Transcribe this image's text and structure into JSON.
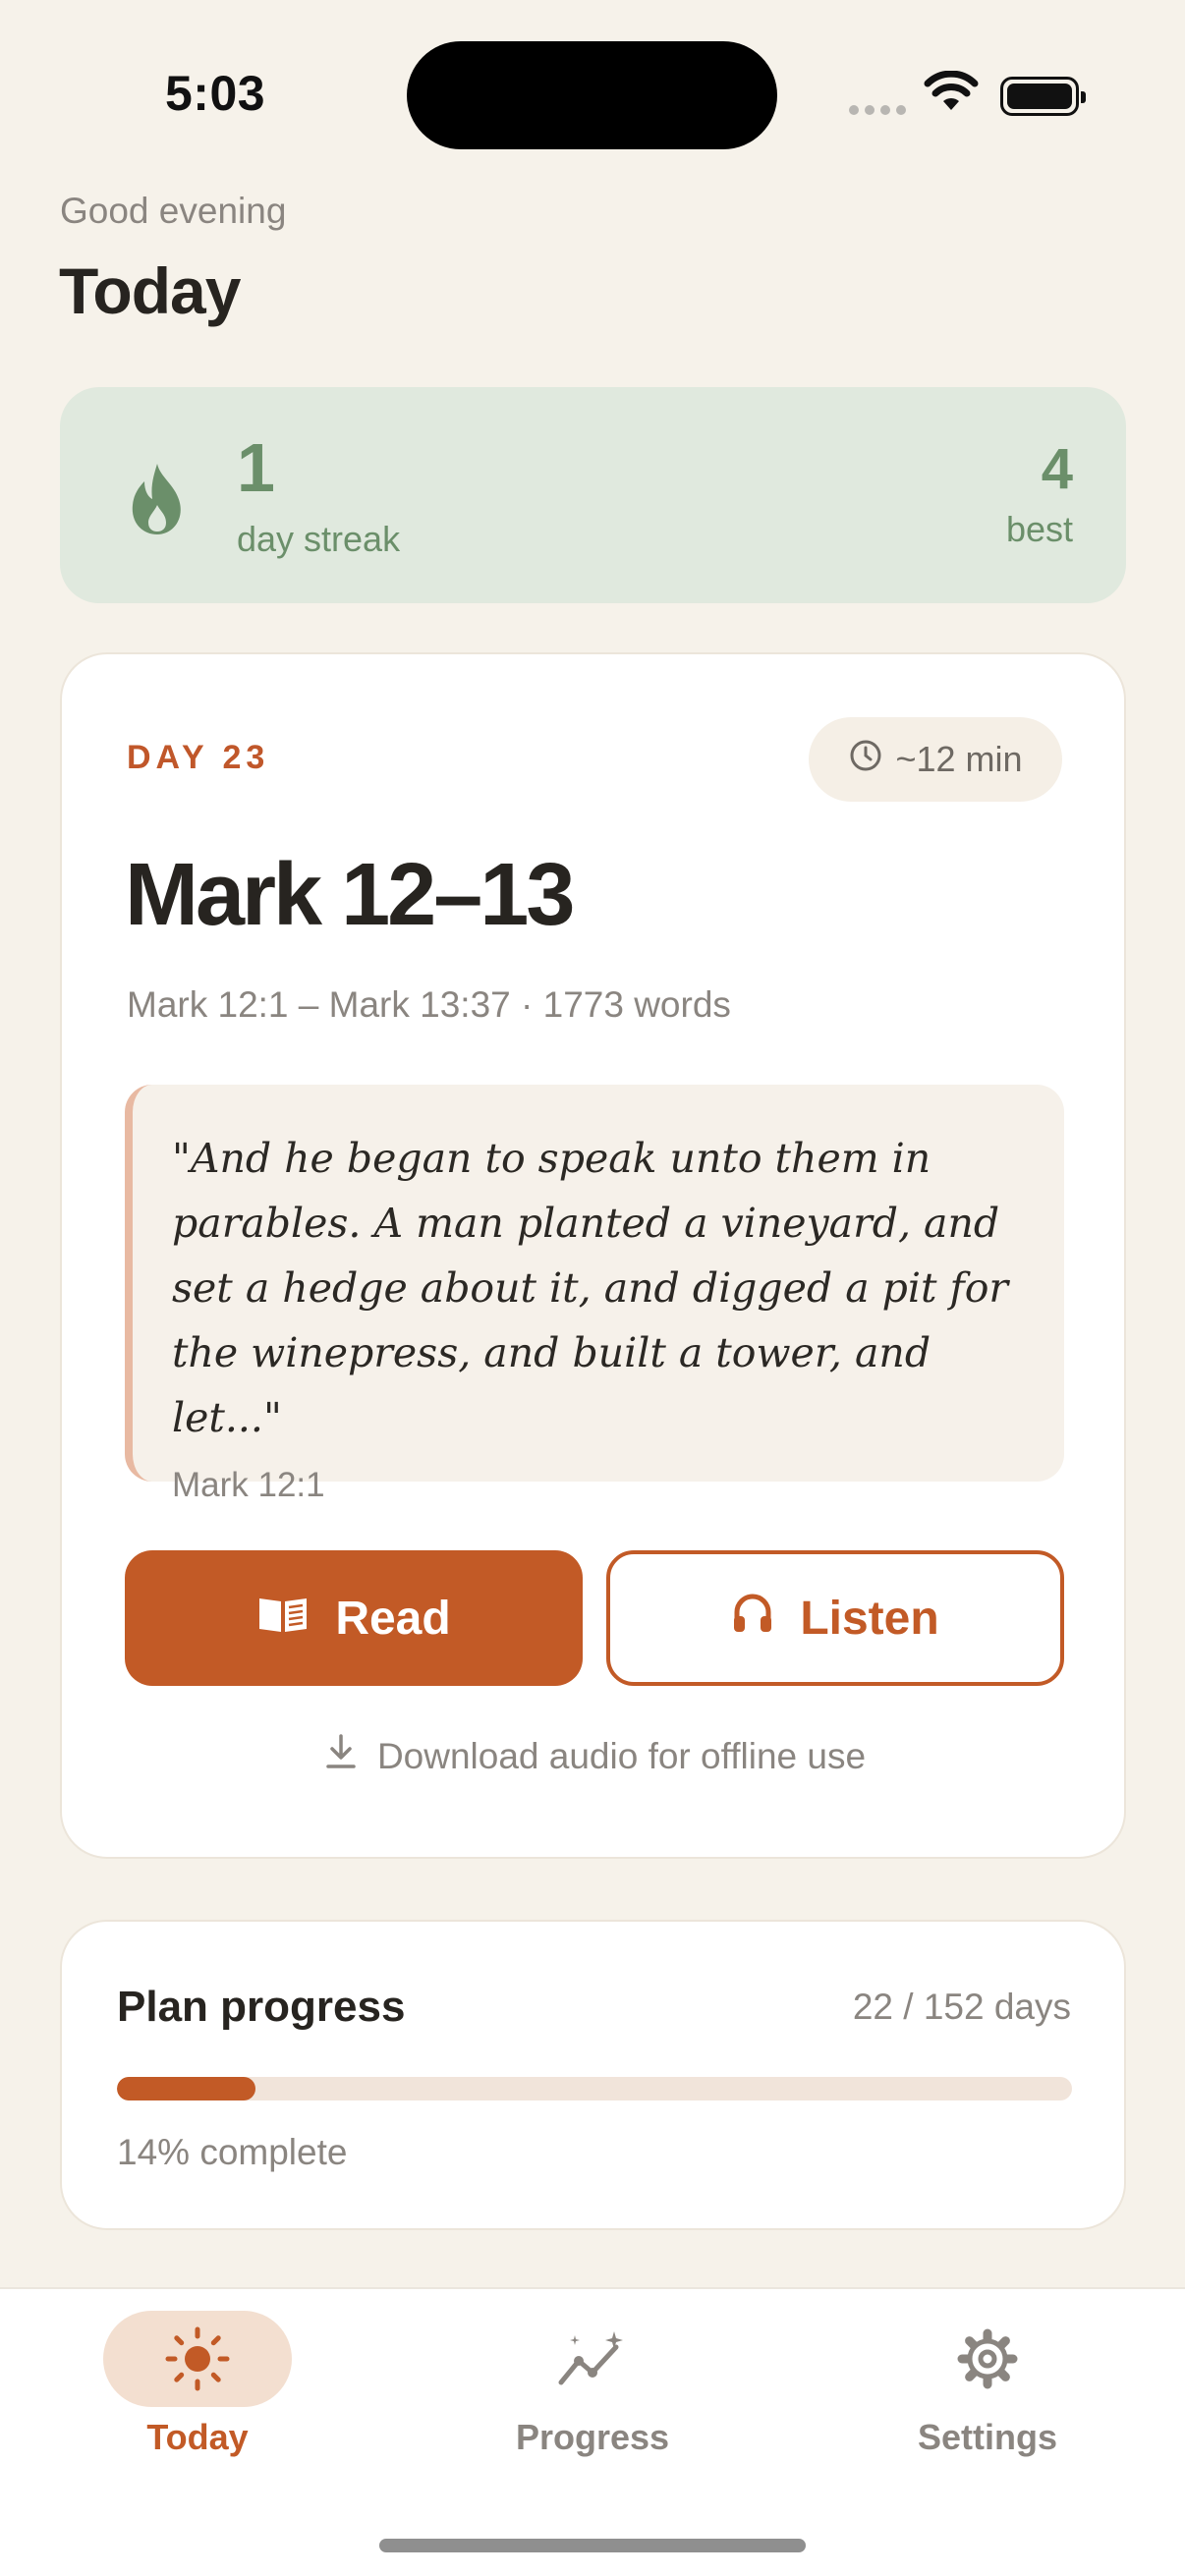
{
  "status_bar": {
    "time": "5:03"
  },
  "header": {
    "greeting": "Good evening",
    "title": "Today"
  },
  "streak": {
    "count": "1",
    "label": "day streak",
    "best_count": "4",
    "best_label": "best"
  },
  "reading": {
    "day_label": "DAY 23",
    "duration": "~12 min",
    "title": "Mark 12–13",
    "range": "Mark 12:1 – Mark 13:37 · 1773 words",
    "quote": "\"And he began to speak unto them in parables. A man planted a vineyard, and set a hedge about it, and digged a pit for the winepress, and built a tower, and let...\"",
    "quote_ref": "Mark 12:1",
    "read_label": "Read",
    "listen_label": "Listen",
    "download_label": "Download audio for offline use"
  },
  "plan": {
    "title": "Plan progress",
    "days": "22 / 152 days",
    "percent_label": "14% complete",
    "progress_fraction": 0.145
  },
  "tabs": [
    {
      "label": "Today",
      "icon": "sun-icon",
      "active": true
    },
    {
      "label": "Progress",
      "icon": "chart-sparkle-icon",
      "active": false
    },
    {
      "label": "Settings",
      "icon": "gear-icon",
      "active": false
    }
  ],
  "colors": {
    "accent": "#c25a26",
    "streak_green": "#6b8f6a",
    "streak_bg": "#e0e9de",
    "background": "#f6f2ea"
  }
}
